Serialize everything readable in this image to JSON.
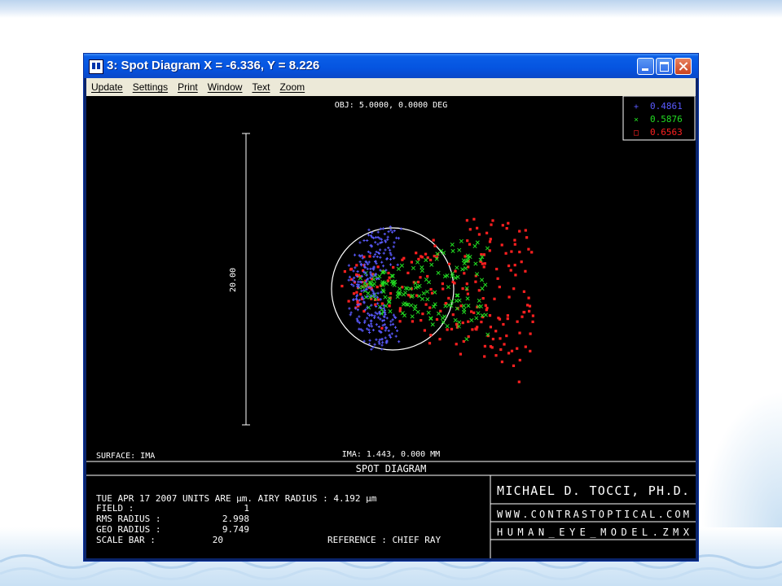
{
  "window": {
    "title": "3: Spot Diagram X = -6.336, Y = 8.226"
  },
  "menu": {
    "items": [
      {
        "label": "Update"
      },
      {
        "label": "Settings"
      },
      {
        "label": "Print"
      },
      {
        "label": "Window"
      },
      {
        "label": "Text"
      },
      {
        "label": "Zoom"
      }
    ]
  },
  "plot": {
    "obj_label": "OBJ: 5.0000, 0.0000 DEG",
    "scale_bar_label": "20.00",
    "surface_label": "SURFACE: IMA",
    "ima_label": "IMA: 1.443, 0.000 MM",
    "legend": [
      {
        "marker": "+",
        "label": "0.4861",
        "color": "#5a5aff"
      },
      {
        "marker": "×",
        "label": "0.5876",
        "color": "#22dd22"
      },
      {
        "marker": "□",
        "label": "0.6563",
        "color": "#ff2020"
      }
    ],
    "footer": {
      "heading": "SPOT DIAGRAM",
      "info_line1": "TUE APR 17 2007  UNITS ARE µm.  AIRY RADIUS : 4.192 µm",
      "field_label": "FIELD      :",
      "field_value": "1",
      "rms_label": "RMS RADIUS :",
      "rms_value": "2.998",
      "geo_label": "GEO RADIUS :",
      "geo_value": "9.749",
      "scale_label": "SCALE BAR  :",
      "scale_value": "20",
      "reference": "REFERENCE  : CHIEF RAY",
      "author": "MICHAEL D. TOCCI, PH.D.",
      "website": "WWW.CONTRASTOPTICAL.COM",
      "file": "HUMAN_EYE_MODEL.ZMX"
    }
  },
  "colors": {
    "wl1": "#5a5aff",
    "wl2": "#22dd22",
    "wl3": "#ff2020"
  }
}
